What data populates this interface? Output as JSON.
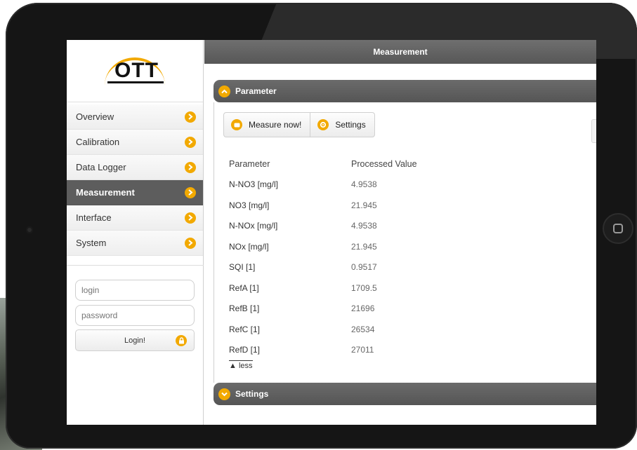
{
  "sidebar": {
    "brand": "OTT",
    "items": [
      {
        "label": "Overview"
      },
      {
        "label": "Calibration"
      },
      {
        "label": "Data Logger"
      },
      {
        "label": "Measurement"
      },
      {
        "label": "Interface"
      },
      {
        "label": "System"
      }
    ],
    "active": "Measurement",
    "login_placeholder": "login",
    "password_placeholder": "password",
    "login_button": "Login!"
  },
  "main": {
    "title": "Measurement",
    "parameter_section": "Parameter",
    "settings_section": "Settings",
    "toolbar": {
      "measure_label": "Measure now!",
      "settings_label": "Settings"
    },
    "table": {
      "headers": [
        "Parameter",
        "Processed Value"
      ],
      "rows": [
        [
          "N-NO3 [mg/l]",
          "4.9538"
        ],
        [
          "NO3 [mg/l]",
          "21.945"
        ],
        [
          "N-NOx [mg/l]",
          "4.9538"
        ],
        [
          "NOx [mg/l]",
          "21.945"
        ],
        [
          "SQI [1]",
          "0.9517"
        ],
        [
          "RefA [1]",
          "1709.5"
        ],
        [
          "RefB [1]",
          "21696"
        ],
        [
          "RefC [1]",
          "26534"
        ],
        [
          "RefD [1]",
          "27011"
        ]
      ]
    },
    "less_label": "▲ less"
  },
  "colors": {
    "accent": "#f2a900",
    "header_bg": "#5d5d5d",
    "active_nav_bg": "#5d5d5d"
  }
}
